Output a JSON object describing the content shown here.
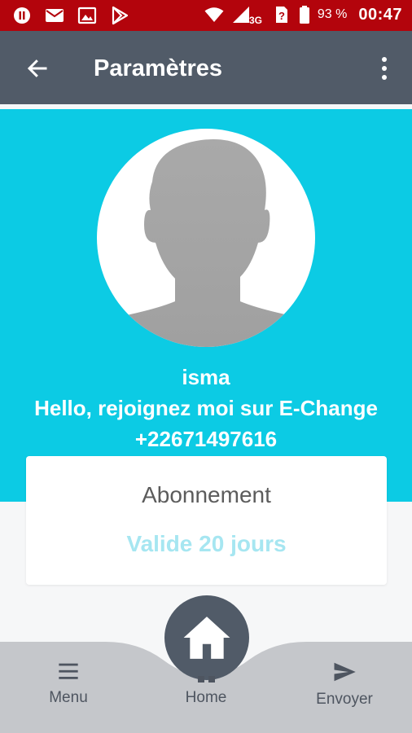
{
  "status_bar": {
    "battery_percent": "93 %",
    "time": "00:47",
    "network": "3G",
    "icons": [
      "notification-icon",
      "mail-icon",
      "image-icon",
      "play-store-icon",
      "wifi-icon",
      "signal-icon",
      "sim-icon",
      "battery-icon"
    ]
  },
  "app_bar": {
    "title": "Paramètres",
    "back_icon": "arrow-back-icon",
    "more_icon": "more-vert-icon"
  },
  "profile": {
    "name": "isma",
    "tagline": "Hello, rejoignez moi sur E-Change",
    "phone": "+22671497616"
  },
  "subscription": {
    "title": "Abonnement",
    "status": "Valide 20 jours"
  },
  "bottom_nav": {
    "menu_label": "Menu",
    "home_label": "Home",
    "send_label": "Envoyer"
  },
  "colors": {
    "status_bar": "#b3040c",
    "app_bar": "#515b68",
    "profile_bg": "#0ccbe4",
    "subscription_status": "#a6e6f1",
    "nav_bg": "#c5c7cb"
  }
}
